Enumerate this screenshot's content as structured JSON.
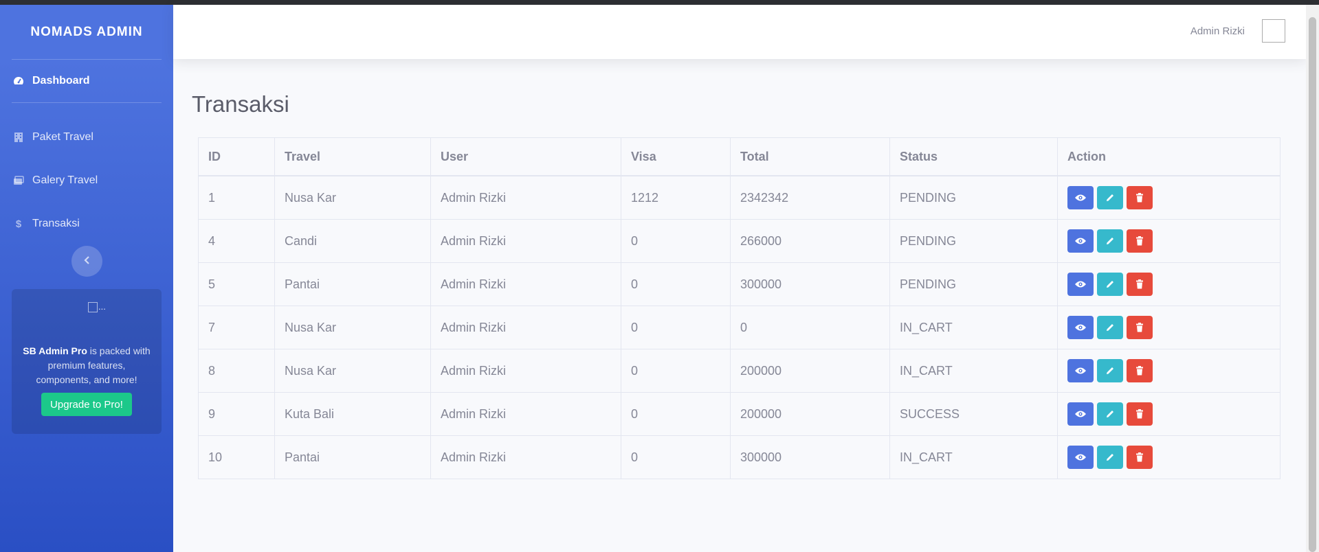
{
  "sidebar": {
    "brand": "NOMADS ADMIN",
    "items": [
      {
        "label": "Dashboard",
        "icon": "tachometer-icon"
      },
      {
        "label": "Paket Travel",
        "icon": "building-icon"
      },
      {
        "label": "Galery Travel",
        "icon": "images-icon"
      },
      {
        "label": "Transaksi",
        "icon": "dollar-icon"
      }
    ],
    "promo": {
      "image_alt": "...",
      "strong": "SB Admin Pro",
      "text": " is packed with premium features, components, and more!",
      "button": "Upgrade to Pro!"
    }
  },
  "topbar": {
    "user_name": "Admin Rizki"
  },
  "page": {
    "title": "Transaksi"
  },
  "table": {
    "headers": [
      "ID",
      "Travel",
      "User",
      "Visa",
      "Total",
      "Status",
      "Action"
    ],
    "rows": [
      [
        "1",
        "Nusa Kar",
        "Admin Rizki",
        "1212",
        "2342342",
        "PENDING"
      ],
      [
        "4",
        "Candi",
        "Admin Rizki",
        "0",
        "266000",
        "PENDING"
      ],
      [
        "5",
        "Pantai",
        "Admin Rizki",
        "0",
        "300000",
        "PENDING"
      ],
      [
        "7",
        "Nusa Kar",
        "Admin Rizki",
        "0",
        "0",
        "IN_CART"
      ],
      [
        "8",
        "Nusa Kar",
        "Admin Rizki",
        "0",
        "200000",
        "IN_CART"
      ],
      [
        "9",
        "Kuta Bali",
        "Admin Rizki",
        "0",
        "200000",
        "SUCCESS"
      ],
      [
        "10",
        "Pantai",
        "Admin Rizki",
        "0",
        "300000",
        "IN_CART"
      ]
    ]
  },
  "colors": {
    "primary": "#4e73df",
    "info": "#36b9cc",
    "danger": "#e74a3b",
    "success": "#1cc88a"
  }
}
